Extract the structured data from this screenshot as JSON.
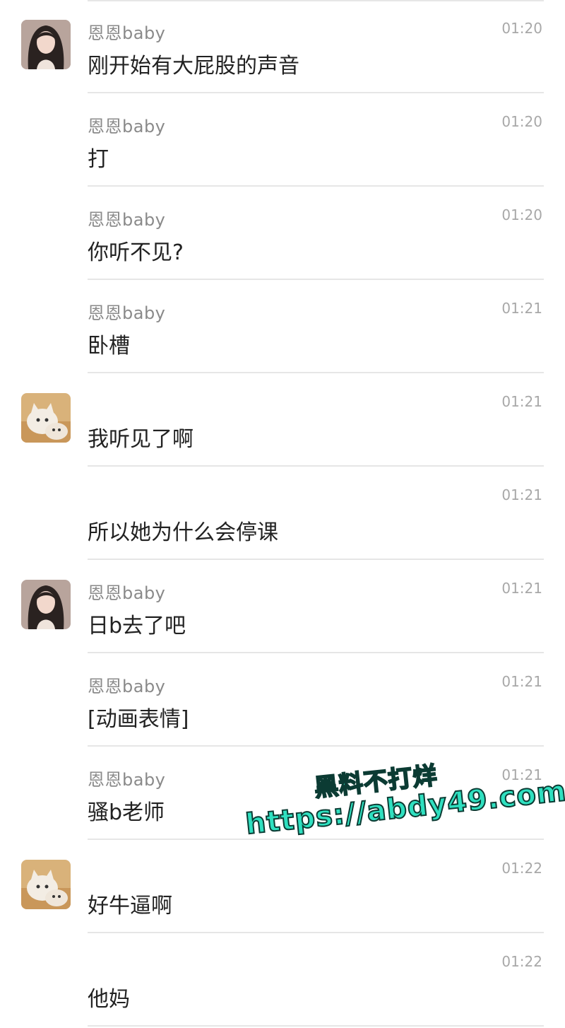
{
  "chat": {
    "messages": [
      {
        "sender": "恩恩baby",
        "time": "01:20",
        "text": "刚开始有大屁股的声音",
        "avatar": "girl"
      },
      {
        "sender": "恩恩baby",
        "time": "01:20",
        "text": "打",
        "avatar": ""
      },
      {
        "sender": "恩恩baby",
        "time": "01:20",
        "text": "你听不见?",
        "avatar": ""
      },
      {
        "sender": "恩恩baby",
        "time": "01:21",
        "text": "卧槽",
        "avatar": ""
      },
      {
        "sender": "",
        "time": "01:21",
        "text": "我听见了啊",
        "avatar": "cat"
      },
      {
        "sender": "",
        "time": "01:21",
        "text": "所以她为什么会停课",
        "avatar": ""
      },
      {
        "sender": "恩恩baby",
        "time": "01:21",
        "text": "日b去了吧",
        "avatar": "girl"
      },
      {
        "sender": "恩恩baby",
        "time": "01:21",
        "text": "[动画表情]",
        "avatar": ""
      },
      {
        "sender": "恩恩baby",
        "time": "01:21",
        "text": "骚b老师",
        "avatar": ""
      },
      {
        "sender": "",
        "time": "01:22",
        "text": "好牛逼啊",
        "avatar": "cat"
      },
      {
        "sender": "",
        "time": "01:22",
        "text": "他妈",
        "avatar": ""
      }
    ]
  },
  "watermark": {
    "line1": "黑料不打烊",
    "line2": "https://abdy49.com"
  }
}
